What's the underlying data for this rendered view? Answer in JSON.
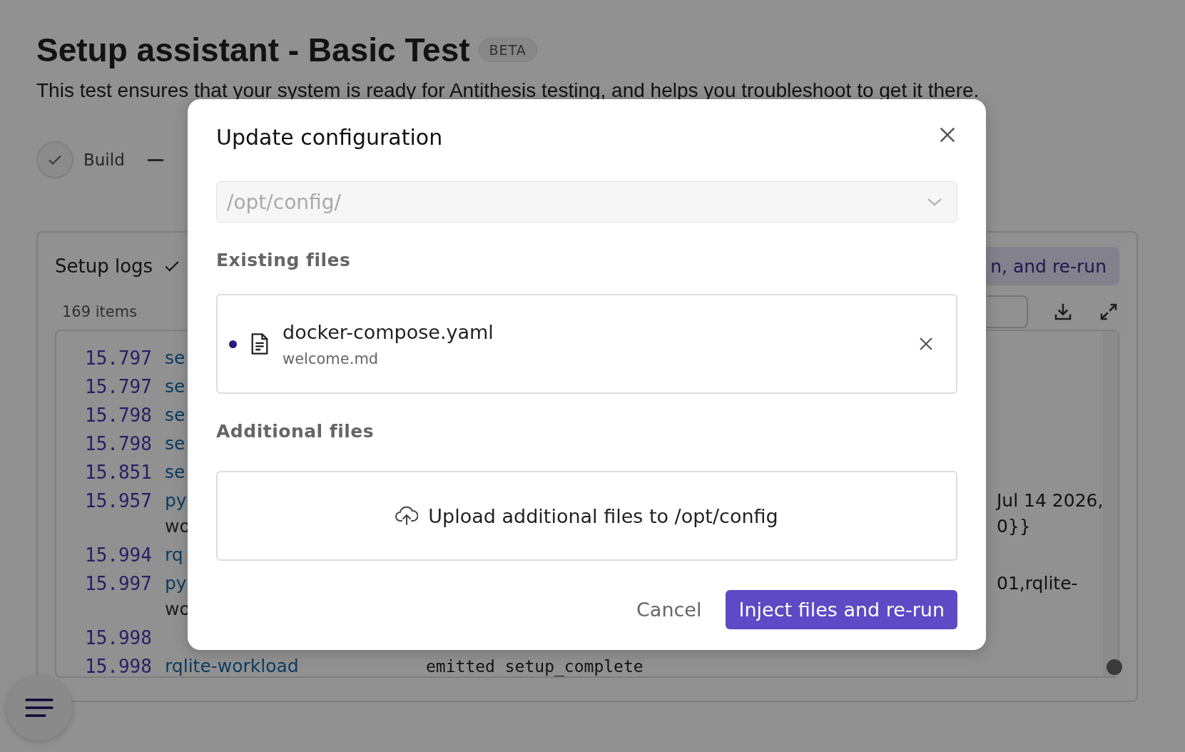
{
  "page": {
    "title": "Setup assistant - Basic Test",
    "badge": "BETA",
    "description": "This test ensures that your system is ready for Antithesis testing, and helps you troubleshoot to get it there."
  },
  "steps": [
    {
      "label": "Build",
      "done": true
    }
  ],
  "logs": {
    "title": "Setup logs",
    "done": true,
    "count": "169 items",
    "action_button": "n, and re-run",
    "rows": [
      {
        "time": "15.797",
        "source": "se",
        "kind": "full"
      },
      {
        "time": "15.797",
        "source": "se",
        "kind": "full"
      },
      {
        "time": "15.798",
        "source": "se",
        "kind": "full"
      },
      {
        "time": "15.798",
        "source": "se",
        "kind": "full"
      },
      {
        "time": "15.851",
        "source": "se",
        "kind": "full"
      },
      {
        "time": "15.957",
        "source": "py",
        "continuation": "wo",
        "kind": "tail",
        "message_lines": [
          "Jul 14 2026,",
          "0}}"
        ]
      },
      {
        "time": "15.994",
        "source": "rq",
        "kind": "full"
      },
      {
        "time": "15.997",
        "source": "py",
        "continuation": "wo",
        "kind": "tail",
        "message_lines": [
          "01,rqlite-"
        ]
      },
      {
        "time": "15.998",
        "kind": "full"
      },
      {
        "time": "15.998",
        "source": "rqlite-workload",
        "kind": "full",
        "message_lines": [
          "emitted setup_complete"
        ]
      }
    ]
  },
  "dialog": {
    "title": "Update configuration",
    "path_select": {
      "placeholder": "/opt/config/"
    },
    "existing_heading": "Existing files",
    "existing_files": [
      {
        "name": "docker-compose.yaml",
        "subtitle": "welcome.md",
        "changed": true
      }
    ],
    "additional_heading": "Additional files",
    "upload_label": "Upload additional files to /opt/config",
    "buttons": [
      {
        "label": "Cancel",
        "kind": "secondary"
      },
      {
        "label": "Inject files and re-run",
        "kind": "primary"
      }
    ]
  }
}
